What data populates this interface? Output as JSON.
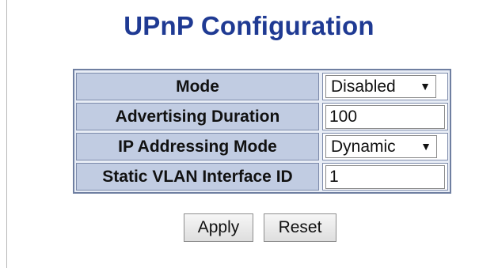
{
  "page": {
    "title": "UPnP Configuration"
  },
  "form": {
    "rows": [
      {
        "label": "Mode",
        "type": "select",
        "value": "Disabled"
      },
      {
        "label": "Advertising Duration",
        "type": "text",
        "value": "100"
      },
      {
        "label": "IP Addressing Mode",
        "type": "select",
        "value": "Dynamic"
      },
      {
        "label": "Static VLAN Interface ID",
        "type": "text",
        "value": "1"
      }
    ]
  },
  "buttons": {
    "apply_label": "Apply",
    "reset_label": "Reset"
  },
  "colors": {
    "title": "#1f3a93",
    "label_bg": "#c1cce2",
    "table_border": "#6f7fa1"
  },
  "icons": {
    "dropdown": "triangle-down-icon"
  }
}
